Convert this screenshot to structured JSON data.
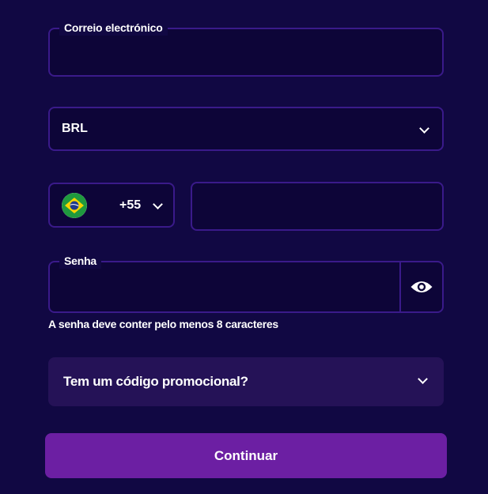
{
  "email": {
    "label": "Correio electrónico",
    "value": "",
    "placeholder": ""
  },
  "currency": {
    "selected": "BRL"
  },
  "phone": {
    "dial_code": "+55",
    "country_icon": "brazil-flag-icon",
    "number": ""
  },
  "password": {
    "label": "Senha",
    "value": "",
    "toggle_icon": "eye-icon"
  },
  "password_hint": "A senha deve conter pelo menos 8 caracteres",
  "promo": {
    "label": "Tem um código promocional?"
  },
  "submit": {
    "label": "Continuar"
  },
  "colors": {
    "background": "#110843",
    "field_border": "#3a1a8a",
    "promo_bg": "#251257",
    "button_bg": "#6c1fa3"
  }
}
